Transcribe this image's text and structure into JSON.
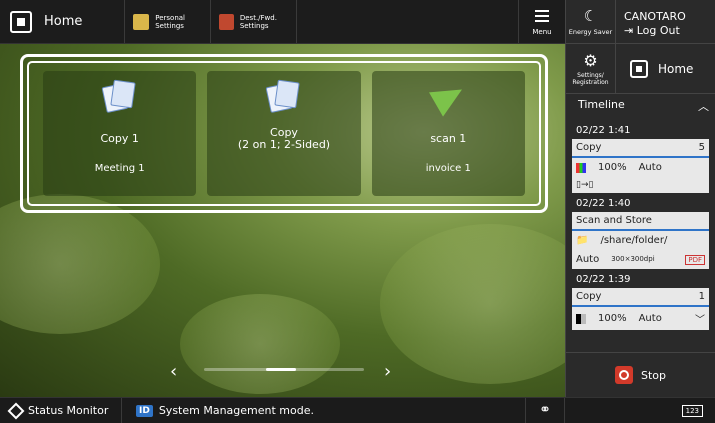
{
  "topbar": {
    "home_label": "Home",
    "personal_settings_label": "Personal Settings",
    "dest_fwd_settings_label": "Dest./Fwd. Settings",
    "menu_label": "Menu"
  },
  "tiles": [
    {
      "title": "Copy 1",
      "subtitle": "Meeting 1",
      "icon": "copy-documents-icon"
    },
    {
      "title": "Copy\n(2 on 1; 2-Sided)",
      "subtitle": "",
      "icon": "copy-documents-icon"
    },
    {
      "title": "scan 1",
      "subtitle": "invoice 1",
      "icon": "paper-plane-icon"
    }
  ],
  "pager": {
    "prev": "‹",
    "next": "›"
  },
  "right": {
    "energy_label": "Energy Saver",
    "user_name": "CANOTARO",
    "logout_label": "Log Out",
    "settings_label": "Settings/ Registration",
    "home_label": "Home",
    "timeline_label": "Timeline",
    "jobs": [
      {
        "time": "02/22 1:41",
        "name": "Copy",
        "count": "5",
        "zoom": "100%",
        "mode": "Auto",
        "color": "color"
      },
      {
        "time": "02/22 1:40",
        "name": "Scan and Store",
        "path": "/share/folder/",
        "mode": "Auto",
        "resolution": "300×300dpi",
        "format": "PDF"
      },
      {
        "time": "02/22 1:39",
        "name": "Copy",
        "count": "1",
        "zoom": "100%",
        "mode": "Auto",
        "color": "bw"
      }
    ],
    "stop_label": "Stop"
  },
  "bottombar": {
    "status_monitor_label": "Status Monitor",
    "id_badge": "ID",
    "system_message": "System Management mode.",
    "keyboard_label": "123"
  },
  "colors": {
    "accent": "#2f74c8",
    "stop": "#d23a2a"
  }
}
